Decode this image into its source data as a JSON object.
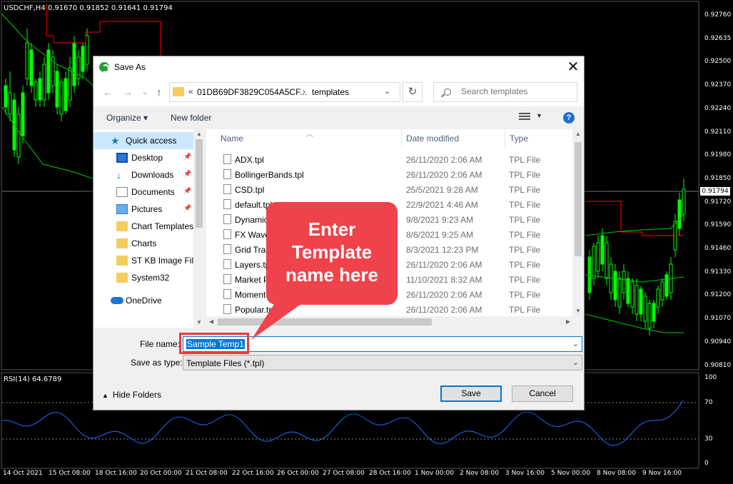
{
  "chart": {
    "symbol_info": "USDCHF,H4  0.91670 0.91852 0.91641 0.91794",
    "price_ticks": [
      "0.92760",
      "0.92635",
      "0.92500",
      "0.92370",
      "0.92240",
      "0.92110",
      "0.91980",
      "0.91850",
      "0.91720",
      "0.91590",
      "0.91460",
      "0.91330",
      "0.91200",
      "0.91070",
      "0.90940",
      "0.90810"
    ],
    "current_price": "0.91794",
    "rsi_label": "RSI(14) 64.6789",
    "rsi_ticks": [
      "100",
      "70",
      "30",
      "0"
    ],
    "date_ticks": [
      "14 Oct 2021",
      "15 Oct 08:00",
      "18 Oct 16:00",
      "20 Oct 00:00",
      "21 Oct 08:00",
      "22 Oct 16:00",
      "26 Oct 00:00",
      "27 Oct 08:00",
      "28 Oct 16:00",
      "1 Nov 00:00",
      "2 Nov 08:00",
      "3 Nov 16:00",
      "5 Nov 00:00",
      "8 Nov 08:00",
      "9 Nov 16:00"
    ],
    "colors": {
      "bull_candle": "#00ff00",
      "bear_candle": "#00ff00",
      "envelope": "#00cc00",
      "stop_line": "#ff0000",
      "rsi_line": "#1e6fff"
    }
  },
  "dialog": {
    "title": "Save As",
    "close_glyph": "✕",
    "nav": {
      "back": "←",
      "forward": "→",
      "history": "⌄",
      "up": "↑",
      "refresh": "↻"
    },
    "address": {
      "chevrons": "«",
      "path_segment": "01DB69DF3829C054A5CF...",
      "separator": "›",
      "current": "templates",
      "dropdown": "⌄"
    },
    "search_placeholder": "Search templates",
    "toolbar": {
      "organize": "Organize ▾",
      "new_folder": "New folder",
      "views_dropdown": "▼",
      "help": "?"
    },
    "nav_pane": [
      {
        "label": "Quick access",
        "icon": "star-icon",
        "selected": true
      },
      {
        "label": "Desktop",
        "icon": "desktop-icon",
        "pinned": true
      },
      {
        "label": "Downloads",
        "icon": "download-icon",
        "pinned": true
      },
      {
        "label": "Documents",
        "icon": "documents-icon",
        "pinned": true
      },
      {
        "label": "Pictures",
        "icon": "pictures-icon",
        "pinned": true
      },
      {
        "label": "Chart Templates",
        "icon": "folder-icon"
      },
      {
        "label": "Charts",
        "icon": "folder-icon"
      },
      {
        "label": "ST KB Image File",
        "icon": "folder-icon"
      },
      {
        "label": "System32",
        "icon": "folder-icon"
      },
      {
        "label": "OneDrive",
        "icon": "onedrive-icon"
      }
    ],
    "columns": {
      "name": "Name",
      "date": "Date modified",
      "type": "Type"
    },
    "files": [
      {
        "name": "ADX.tpl",
        "date": "26/11/2020 2:06 AM",
        "type": "TPL File"
      },
      {
        "name": "BollingerBands.tpl",
        "date": "26/11/2020 2:06 AM",
        "type": "TPL File"
      },
      {
        "name": "CSD.tpl",
        "date": "25/5/2021 9:28 AM",
        "type": "TPL File"
      },
      {
        "name": "default.tpl",
        "date": "22/9/2021 4:46 AM",
        "type": "TPL File"
      },
      {
        "name": "Dynamic",
        "date": "9/8/2021 9:23 AM",
        "type": "TPL File"
      },
      {
        "name": "FX Wave",
        "date": "8/6/2021 9:25 AM",
        "type": "TPL File"
      },
      {
        "name": "Grid Trad",
        "date": "8/3/2021 12:23 PM",
        "type": "TPL File"
      },
      {
        "name": "Layers.tp",
        "date": "26/11/2020 2:06 AM",
        "type": "TPL File"
      },
      {
        "name": "Market P",
        "date": "11/10/2021 8:32 AM",
        "type": "TPL File"
      },
      {
        "name": "Momentu",
        "date": "26/11/2020 2:06 AM",
        "type": "TPL File"
      },
      {
        "name": "Popular.tpl",
        "date": "26/11/2020 2:06 AM",
        "type": "TPL File"
      }
    ],
    "file_name_label": "File name:",
    "file_name_value": "Sample Temp1",
    "save_type_label": "Save as type:",
    "save_type_value": "Template Files (*.tpl)",
    "hide_folders": "Hide Folders",
    "save_button": "Save",
    "cancel_button": "Cancel"
  },
  "annotation": {
    "callout_lines": [
      "Enter",
      "Template",
      "name here"
    ],
    "color": "#f0424a"
  }
}
